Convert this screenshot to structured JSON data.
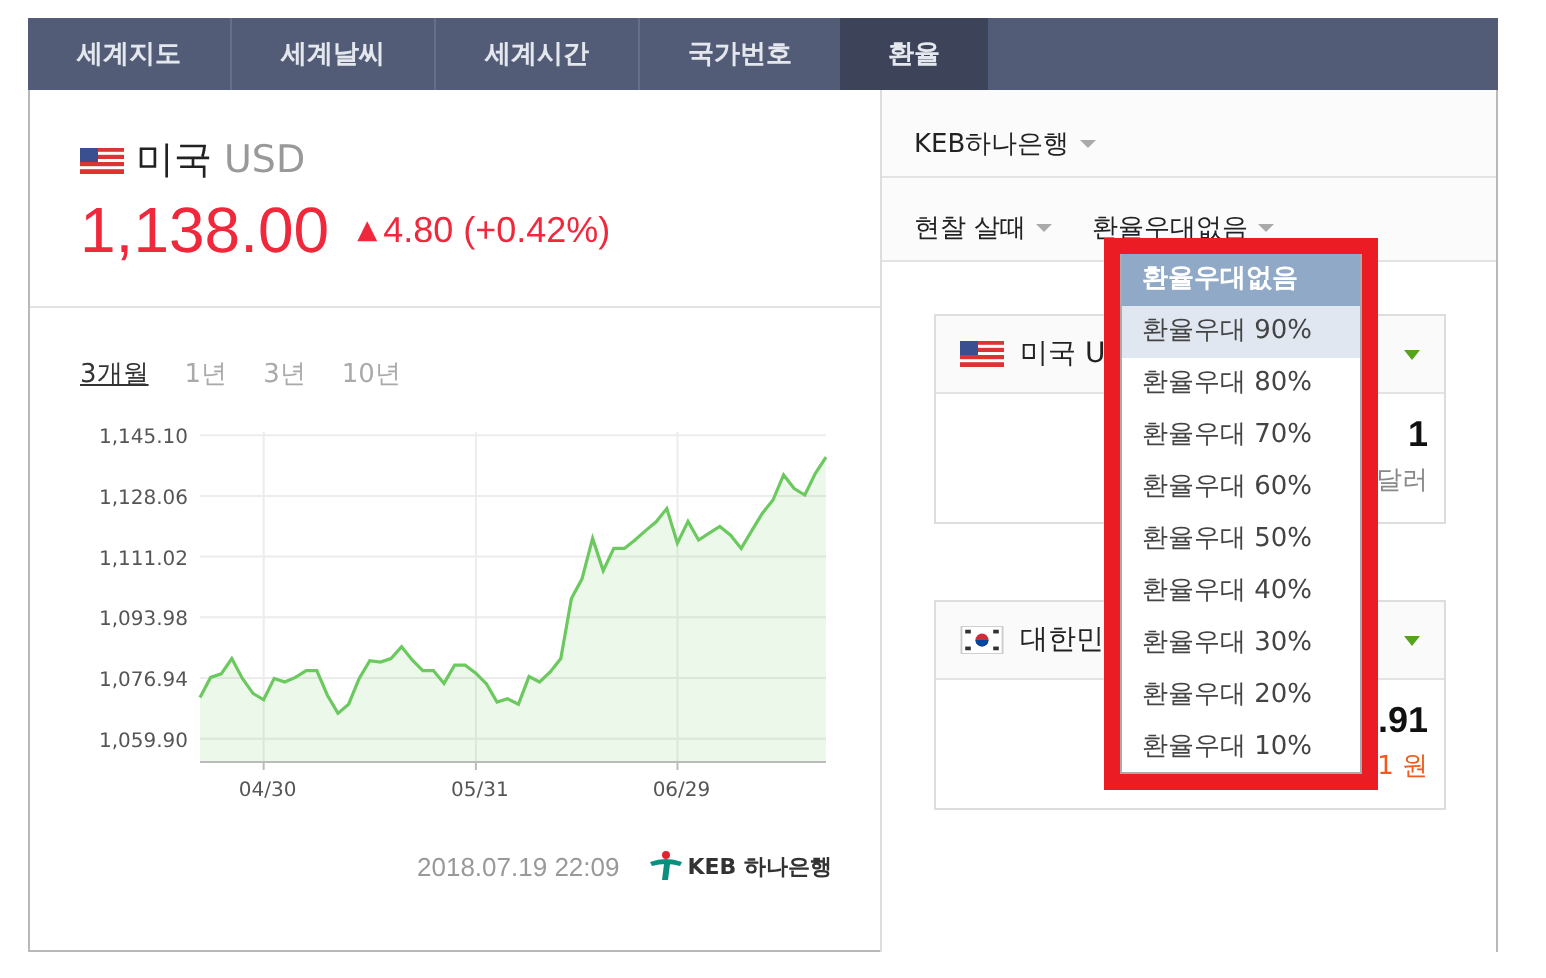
{
  "tabs": [
    {
      "label": "세계지도",
      "selected": false
    },
    {
      "label": "세계날씨",
      "selected": false
    },
    {
      "label": "세계시간",
      "selected": false
    },
    {
      "label": "국가번호",
      "selected": false
    },
    {
      "label": "환율",
      "selected": true
    }
  ],
  "quote": {
    "country": "미국",
    "code": "USD",
    "price": "1,138.00",
    "arrow": "▲",
    "change": "4.80 (+0.42%)"
  },
  "periods": [
    {
      "label": "3개월",
      "selected": true
    },
    {
      "label": "1년",
      "selected": false
    },
    {
      "label": "3년",
      "selected": false
    },
    {
      "label": "10년",
      "selected": false
    }
  ],
  "chart_data": {
    "type": "area",
    "grid": true,
    "ylim": [
      1053.35,
      1146.0
    ],
    "categories": [
      null,
      null,
      null,
      null,
      null,
      null,
      "04/30",
      null,
      null,
      null,
      null,
      null,
      null,
      null,
      null,
      null,
      null,
      null,
      null,
      null,
      null,
      null,
      null,
      null,
      null,
      null,
      "05/31",
      null,
      null,
      null,
      null,
      null,
      null,
      null,
      null,
      null,
      null,
      null,
      null,
      null,
      null,
      null,
      null,
      null,
      null,
      "06/29",
      null,
      null,
      null,
      null,
      null,
      null,
      null,
      null,
      null,
      null,
      null,
      null,
      null,
      null
    ],
    "yticks": [
      {
        "value": 1059.9,
        "label": "1,059.90"
      },
      {
        "value": 1076.94,
        "label": "1,076.94"
      },
      {
        "value": 1093.98,
        "label": "1,093.98"
      },
      {
        "value": 1111.02,
        "label": "1,111.02"
      },
      {
        "value": 1128.06,
        "label": "1,128.06"
      },
      {
        "value": 1145.1,
        "label": "1,145.10"
      }
    ],
    "series": [
      {
        "color": "#6cc95f",
        "values": [
          1071.5,
          1077.1,
          1078.1,
          1082.4,
          1076.8,
          1072.6,
          1070.8,
          1076.8,
          1075.8,
          1077.1,
          1079.0,
          1079.0,
          1072.1,
          1067.0,
          1069.6,
          1076.8,
          1081.8,
          1081.4,
          1082.4,
          1085.7,
          1082.0,
          1079.0,
          1079.0,
          1075.4,
          1080.5,
          1080.5,
          1078.3,
          1075.3,
          1070.2,
          1071.1,
          1069.6,
          1077.3,
          1075.8,
          1078.6,
          1082.4,
          1099.2,
          1104.8,
          1116.1,
          1107.1,
          1113.3,
          1113.3,
          1115.7,
          1118.3,
          1120.8,
          1124.5,
          1114.8,
          1120.9,
          1115.7,
          1117.6,
          1119.5,
          1117.0,
          1113.3,
          1118.3,
          1123.2,
          1126.9,
          1133.9,
          1130.1,
          1128.3,
          1134.4,
          1138.9
        ]
      }
    ]
  },
  "updated": "2018.07.19 22:09",
  "source_logo": "KEB 하나은행",
  "bank_select": "KEB하나은행",
  "rate_type_select": "현찰 살때",
  "preference_select": "환율우대없음",
  "cards": [
    {
      "kind": "us",
      "name": "미국 U",
      "amount": "1",
      "unit": "달러",
      "color": "#888888"
    },
    {
      "kind": "kr",
      "name": "대한민",
      "amount": ".91",
      "unit": "1 원",
      "color": "#f05a1e"
    }
  ],
  "dropdown": [
    {
      "label": "환율우대없음",
      "selected": true,
      "hovered": false
    },
    {
      "label": "환율우대 90%",
      "selected": false,
      "hovered": true
    },
    {
      "label": "환율우대 80%",
      "selected": false,
      "hovered": false
    },
    {
      "label": "환율우대 70%",
      "selected": false,
      "hovered": false
    },
    {
      "label": "환율우대 60%",
      "selected": false,
      "hovered": false
    },
    {
      "label": "환율우대 50%",
      "selected": false,
      "hovered": false
    },
    {
      "label": "환율우대 40%",
      "selected": false,
      "hovered": false
    },
    {
      "label": "환율우대 30%",
      "selected": false,
      "hovered": false
    },
    {
      "label": "환율우대 20%",
      "selected": false,
      "hovered": false
    },
    {
      "label": "환율우대 10%",
      "selected": false,
      "hovered": false
    }
  ]
}
